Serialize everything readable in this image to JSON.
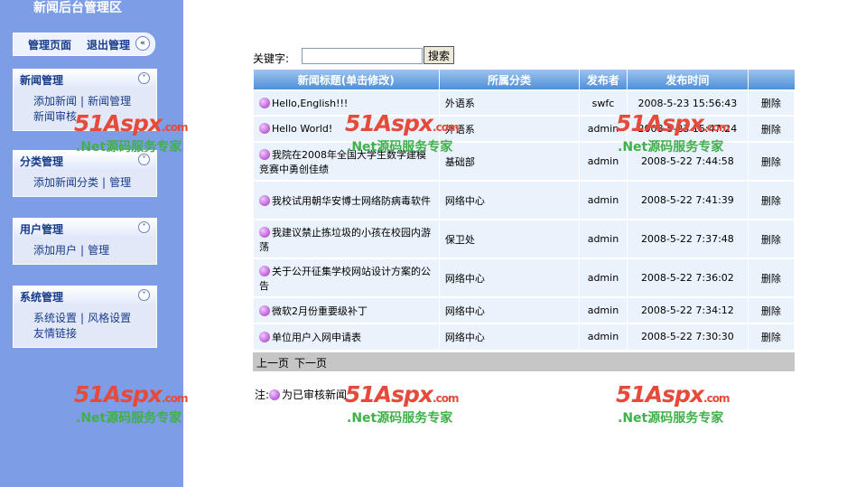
{
  "sidebar": {
    "title": "新闻后台管理区",
    "top": {
      "manage_page": "管理页面",
      "logout": "退出管理"
    },
    "groups": [
      {
        "title": "新闻管理",
        "links": [
          "添加新闻",
          "新闻管理",
          "新闻审核"
        ]
      },
      {
        "title": "分类管理",
        "links": [
          "添加新闻分类",
          "管理"
        ]
      },
      {
        "title": "用户管理",
        "links": [
          "添加用户",
          "管理"
        ]
      },
      {
        "title": "系统管理",
        "links": [
          "系统设置",
          "风格设置",
          "友情链接"
        ]
      }
    ]
  },
  "search": {
    "label": "关键字:",
    "value": "",
    "button": "搜索"
  },
  "table": {
    "headers": [
      "新闻标题(单击修改)",
      "所属分类",
      "发布者",
      "发布时间",
      ""
    ],
    "rows": [
      {
        "title": "Hello,English!!!",
        "category": "外语系",
        "author": "swfc",
        "time": "2008-5-23 15:56:43",
        "action": "删除"
      },
      {
        "title": "Hello World!",
        "category": "外语系",
        "author": "admin",
        "time": "2008-5-23 15:47:24",
        "action": "删除"
      },
      {
        "title": "我院在2008年全国大学生数学建模竞赛中勇创佳绩",
        "category": "基础部",
        "author": "admin",
        "time": "2008-5-22 7:44:58",
        "action": "删除"
      },
      {
        "title": "我校试用朝华安博士网络防病毒软件",
        "category": "网络中心",
        "author": "admin",
        "time": "2008-5-22 7:41:39",
        "action": "删除"
      },
      {
        "title": "我建议禁止拣垃圾的小孩在校园内游荡",
        "category": "保卫处",
        "author": "admin",
        "time": "2008-5-22 7:37:48",
        "action": "删除"
      },
      {
        "title": "关于公开征集学校网站设计方案的公告",
        "category": "网络中心",
        "author": "admin",
        "time": "2008-5-22 7:36:02",
        "action": "删除"
      },
      {
        "title": "微软2月份重要级补丁",
        "category": "网络中心",
        "author": "admin",
        "time": "2008-5-22 7:34:12",
        "action": "删除"
      },
      {
        "title": "单位用户入网申请表",
        "category": "网络中心",
        "author": "admin",
        "time": "2008-5-22 7:30:30",
        "action": "删除"
      }
    ]
  },
  "pager": {
    "prev": "上一页",
    "next": "下一页"
  },
  "note": {
    "prefix": "注:",
    "text": "为已审核新闻"
  },
  "watermark": {
    "logo": "51Aspx",
    "domain": ".com",
    "slogan": ".Net源码服务专家"
  },
  "colors": {
    "sidebar_bg": "#7d9de6",
    "header_blue": "#4f8fd9",
    "row_bg": "#eaf2fb",
    "pager_bg": "#c6c6c6",
    "approved_dot": "#a32fc4"
  }
}
